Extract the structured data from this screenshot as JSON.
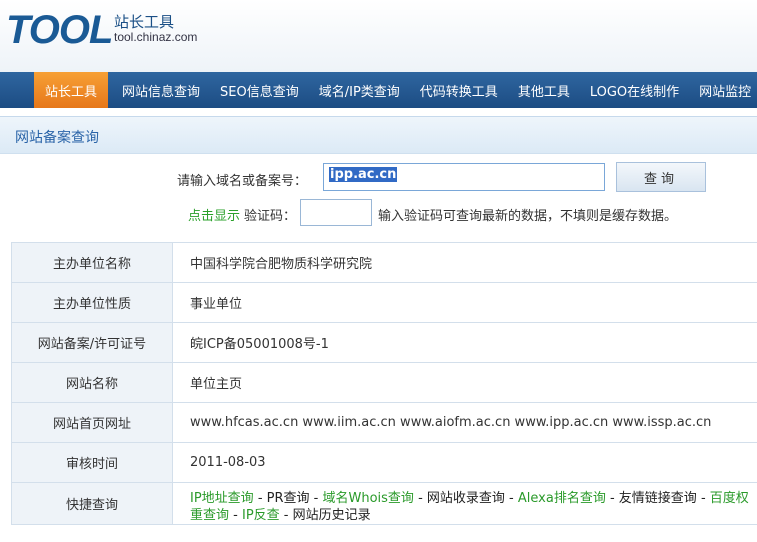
{
  "header": {
    "logo_word": "TOOL",
    "logo_cn": "站长工具",
    "logo_domain": "tool.chinaz.com"
  },
  "nav": {
    "items": [
      {
        "label": "站长工具",
        "active": true
      },
      {
        "label": "网站信息查询"
      },
      {
        "label": "SEO信息查询"
      },
      {
        "label": "域名/IP类查询"
      },
      {
        "label": "代码转换工具"
      },
      {
        "label": "其他工具"
      },
      {
        "label": "LOGO在线制作"
      },
      {
        "label": "网站监控"
      }
    ]
  },
  "page_title": "网站备案查询",
  "form": {
    "domain_label": "请输入域名或备案号：",
    "domain_value": "ipp.ac.cn",
    "query_button": "查询",
    "captcha_link": "点击显示",
    "captcha_label": "验证码：",
    "captcha_value": "",
    "captcha_hint": "输入验证码可查询最新的数据，不填则是缓存数据。"
  },
  "results": {
    "rows": [
      {
        "label": "主办单位名称",
        "value": "中国科学院合肥物质科学研究院"
      },
      {
        "label": "主办单位性质",
        "value": "事业单位"
      },
      {
        "label": "网站备案/许可证号",
        "value": "皖ICP备05001008号-1"
      },
      {
        "label": "网站名称",
        "value": "单位主页"
      },
      {
        "label": "网站首页网址",
        "value": "www.hfcas.ac.cn www.iim.ac.cn www.aiofm.ac.cn www.ipp.ac.cn www.issp.ac.cn"
      },
      {
        "label": "审核时间",
        "value": "2011-08-03"
      }
    ],
    "quick_label": "快捷查询",
    "quick_links": [
      {
        "label": "IP地址查询",
        "green": true
      },
      {
        "label": "PR查询",
        "green": false
      },
      {
        "label": "域名Whois查询",
        "green": true
      },
      {
        "label": "网站收录查询",
        "green": false
      },
      {
        "label": "Alexa排名查询",
        "green": true
      },
      {
        "label": "友情链接查询",
        "green": false
      },
      {
        "label": "百度权重查询",
        "green": true
      },
      {
        "label": "IP反查",
        "green": true
      },
      {
        "label": "网站历史记录",
        "green": false
      }
    ],
    "separator": " - "
  }
}
